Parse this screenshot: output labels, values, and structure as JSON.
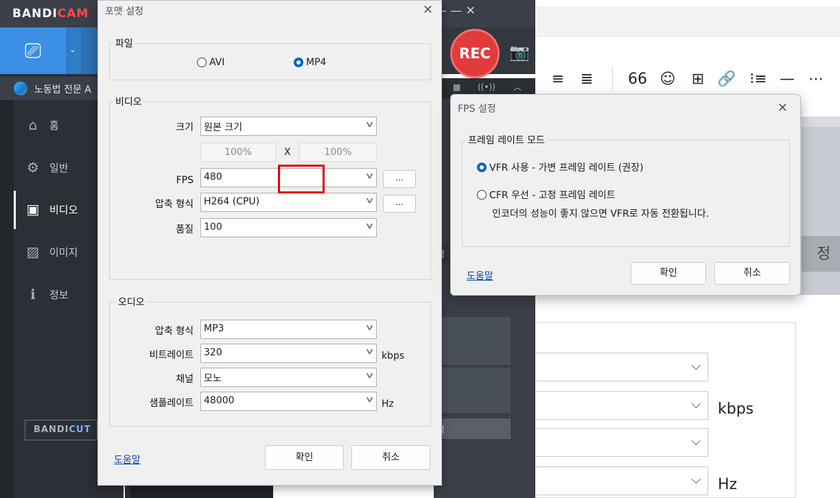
{
  "editor": {
    "toolbar_icons": [
      "align-right-icon",
      "align-justify-icon",
      "quote-icon",
      "emoji-icon",
      "table-icon",
      "link-icon",
      "list-icon",
      "divider-icon",
      "more-icon"
    ],
    "toolbar_glyphs": [
      "≡",
      "≣",
      "66",
      "☺",
      "⊞",
      "🔗",
      "⁝≡",
      "—",
      "⋯"
    ],
    "strip_text": "정",
    "units": {
      "kbps": "kbps",
      "hz": "Hz"
    }
  },
  "bandicam": {
    "logo_main": "BANDI",
    "logo_accent": "CAM",
    "window_controls": "‒   —   ✕",
    "rec_label": "REC",
    "browser_tab": "노동법 전문 A",
    "sidebar": [
      {
        "label": "홈",
        "icon": "home-icon",
        "glyph": "⌂"
      },
      {
        "label": "일반",
        "icon": "gear-icon",
        "glyph": "⚙"
      },
      {
        "label": "비디오",
        "icon": "video-settings-icon",
        "glyph": "▣",
        "active": true
      },
      {
        "label": "이미지",
        "icon": "image-settings-icon",
        "glyph": "▨"
      },
      {
        "label": "정보",
        "icon": "info-icon",
        "glyph": "ℹ"
      }
    ],
    "bandicut_main": "BANDI",
    "bandicut_accent": "CUT",
    "right_panel_texts": [
      "정",
      "정"
    ]
  },
  "format_dialog": {
    "title": "포맷 설정",
    "file_group": "파일",
    "file_options": [
      "AVI",
      "MP4"
    ],
    "file_selected": "MP4",
    "video_group": "비디오",
    "size_label": "크기",
    "size_value": "원본 크기",
    "width_pct": "100%",
    "x_label": "X",
    "height_pct": "100%",
    "fps_label": "FPS",
    "fps_value": "480",
    "codec_label": "압축 형식",
    "codec_value": "H264 (CPU)",
    "quality_label": "품질",
    "quality_value": "100",
    "more_label": "...",
    "audio_group": "오디오",
    "audio_codec_label": "압축 형식",
    "audio_codec_value": "MP3",
    "bitrate_label": "비트레이트",
    "bitrate_value": "320",
    "bitrate_unit": "kbps",
    "channel_label": "채널",
    "channel_value": "모노",
    "samplerate_label": "샘플레이트",
    "samplerate_value": "48000",
    "samplerate_unit": "Hz",
    "help_link": "도움말",
    "ok_label": "확인",
    "cancel_label": "취소"
  },
  "fps_dialog": {
    "title": "FPS 설정",
    "group_label": "프레임 레이트 모드",
    "option_vfr": "VFR 사용 - 가변 프레임 레이트 (권장)",
    "option_cfr": "CFR 우선 - 고정 프레임 레이트",
    "cfr_note": "인코더의 성능이 좋지 않으면 VFR로 자동 전환됩니다.",
    "selected": "VFR",
    "help_link": "도움말",
    "ok_label": "확인",
    "cancel_label": "취소"
  }
}
